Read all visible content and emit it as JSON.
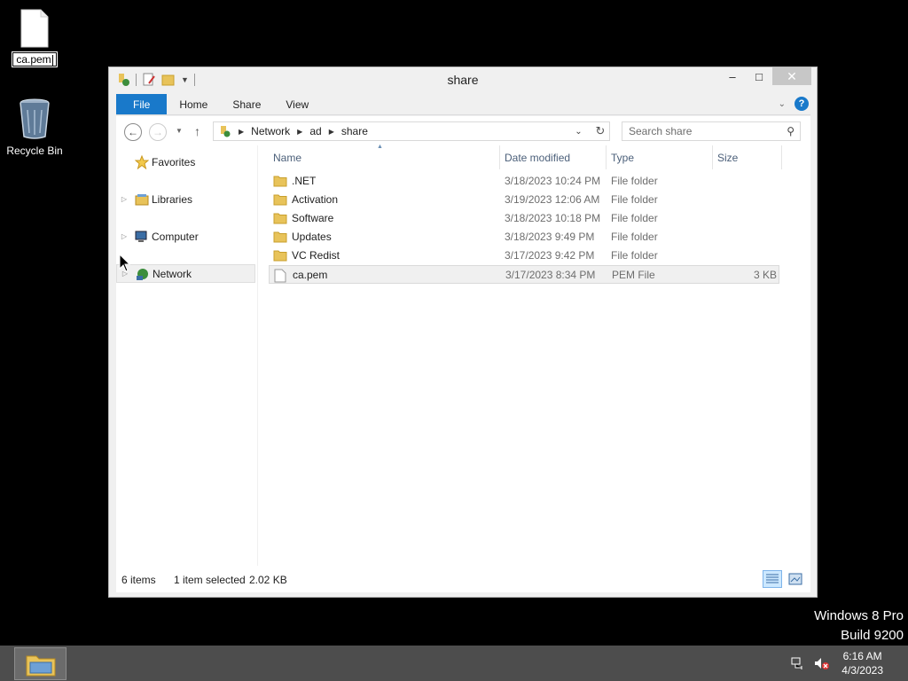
{
  "desktop": {
    "file_icon_label": "ca.pem",
    "recycle_bin_label": "Recycle Bin",
    "watermark_line1": "Windows 8 Pro",
    "watermark_line2": "Build 9200"
  },
  "window": {
    "title": "share",
    "minimize_glyph": "‒",
    "maximize_glyph": "□",
    "close_glyph": "✕"
  },
  "ribbon": {
    "tabs": [
      {
        "label": "File"
      },
      {
        "label": "Home"
      },
      {
        "label": "Share"
      },
      {
        "label": "View"
      }
    ],
    "help_glyph": "?"
  },
  "address": {
    "crumbs": [
      "Network",
      "ad",
      "share"
    ],
    "search_placeholder": "Search share"
  },
  "navpane": {
    "items": [
      {
        "label": "Favorites"
      },
      {
        "label": "Libraries"
      },
      {
        "label": "Computer"
      },
      {
        "label": "Network"
      }
    ]
  },
  "list": {
    "columns": [
      "Name",
      "Date modified",
      "Type",
      "Size"
    ],
    "rows": [
      {
        "name": ".NET",
        "date": "3/18/2023 10:24 PM",
        "type": "File folder",
        "size": ""
      },
      {
        "name": "Activation",
        "date": "3/19/2023 12:06 AM",
        "type": "File folder",
        "size": ""
      },
      {
        "name": "Software",
        "date": "3/18/2023 10:18 PM",
        "type": "File folder",
        "size": ""
      },
      {
        "name": "Updates",
        "date": "3/18/2023 9:49 PM",
        "type": "File folder",
        "size": ""
      },
      {
        "name": "VC Redist",
        "date": "3/17/2023 9:42 PM",
        "type": "File folder",
        "size": ""
      },
      {
        "name": "ca.pem",
        "date": "3/17/2023 8:34 PM",
        "type": "PEM File",
        "size": "3 KB"
      }
    ]
  },
  "status": {
    "item_count": "6 items",
    "selection": "1 item selected",
    "selection_size": "2.02 KB"
  },
  "taskbar": {
    "time": "6:16 AM",
    "date": "4/3/2023"
  },
  "colors": {
    "accent": "#1979ca",
    "folder": "#e8c35a"
  }
}
